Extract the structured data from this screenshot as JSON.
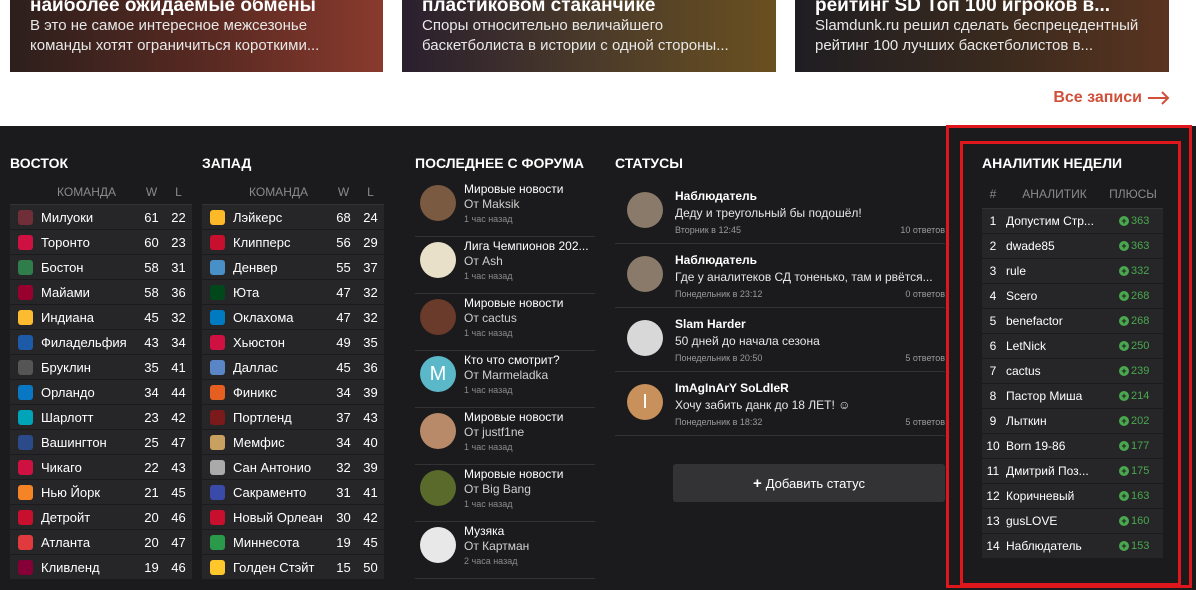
{
  "cards": [
    {
      "title": "наиболее ожидаемые обмены",
      "text1": "В это не самое интересное межсезонье",
      "text2": "команды хотят ограничиться короткими..."
    },
    {
      "title": "пластиковом стаканчике",
      "text1": "Споры относительно величайшего",
      "text2": "баскетболиста в истории с одной стороны..."
    },
    {
      "title": "рейтинг SD Топ 100 игроков в...",
      "text1": "Slamdunk.ru решил сделать беспрецедентный",
      "text2": "рейтинг 100 лучших баскетболистов в..."
    }
  ],
  "all_link": "Все записи",
  "east": {
    "title": "ВОСТОК",
    "col_team": "КОМАНДА",
    "col_w": "W",
    "col_l": "L",
    "rows": [
      {
        "name": "Милуоки",
        "w": "61",
        "l": "22",
        "color": "#702f38"
      },
      {
        "name": "Торонто",
        "w": "60",
        "l": "23",
        "color": "#ce1141"
      },
      {
        "name": "Бостон",
        "w": "58",
        "l": "31",
        "color": "#2e7d4a"
      },
      {
        "name": "Майами",
        "w": "58",
        "l": "36",
        "color": "#98002e"
      },
      {
        "name": "Индиана",
        "w": "45",
        "l": "32",
        "color": "#fdbb30"
      },
      {
        "name": "Филадельфия",
        "w": "43",
        "l": "34",
        "color": "#1d5aa8"
      },
      {
        "name": "Бруклин",
        "w": "35",
        "l": "41",
        "color": "#555555"
      },
      {
        "name": "Орландо",
        "w": "34",
        "l": "44",
        "color": "#0a77c4"
      },
      {
        "name": "Шарлотт",
        "w": "23",
        "l": "42",
        "color": "#00a4b8"
      },
      {
        "name": "Вашингтон",
        "w": "25",
        "l": "47",
        "color": "#2a4a8a"
      },
      {
        "name": "Чикаго",
        "w": "22",
        "l": "43",
        "color": "#ce1141"
      },
      {
        "name": "Нью Йорк",
        "w": "21",
        "l": "45",
        "color": "#f58426"
      },
      {
        "name": "Детройт",
        "w": "20",
        "l": "46",
        "color": "#c8102e"
      },
      {
        "name": "Атланта",
        "w": "20",
        "l": "47",
        "color": "#e03a3e"
      },
      {
        "name": "Кливленд",
        "w": "19",
        "l": "46",
        "color": "#860038"
      }
    ]
  },
  "west": {
    "title": "ЗАПАД",
    "col_team": "КОМАНДА",
    "col_w": "W",
    "col_l": "L",
    "rows": [
      {
        "name": "Лэйкерс",
        "w": "68",
        "l": "24",
        "color": "#fdb927"
      },
      {
        "name": "Клипперс",
        "w": "56",
        "l": "29",
        "color": "#c8102e"
      },
      {
        "name": "Денвер",
        "w": "55",
        "l": "37",
        "color": "#4a90c8"
      },
      {
        "name": "Юта",
        "w": "47",
        "l": "32",
        "color": "#00471b"
      },
      {
        "name": "Оклахома",
        "w": "47",
        "l": "32",
        "color": "#007ac1"
      },
      {
        "name": "Хьюстон",
        "w": "49",
        "l": "35",
        "color": "#ce1141"
      },
      {
        "name": "Даллас",
        "w": "45",
        "l": "36",
        "color": "#5a86c8"
      },
      {
        "name": "Финикс",
        "w": "34",
        "l": "39",
        "color": "#e56020"
      },
      {
        "name": "Портленд",
        "w": "37",
        "l": "43",
        "color": "#7a1a1a"
      },
      {
        "name": "Мемфис",
        "w": "34",
        "l": "40",
        "color": "#c8a060"
      },
      {
        "name": "Сан Антонио",
        "w": "32",
        "l": "39",
        "color": "#aaaaaa"
      },
      {
        "name": "Сакраменто",
        "w": "31",
        "l": "41",
        "color": "#3a4aa8"
      },
      {
        "name": "Новый Орлеан",
        "w": "30",
        "l": "42",
        "color": "#c8102e"
      },
      {
        "name": "Миннесота",
        "w": "19",
        "l": "45",
        "color": "#2a9a4a"
      },
      {
        "name": "Голден Стэйт",
        "w": "15",
        "l": "50",
        "color": "#ffc72c"
      }
    ]
  },
  "forum": {
    "title": "ПОСЛЕДНЕЕ С ФОРУМА",
    "items": [
      {
        "topic": "Мировые новости",
        "author": "От Maksik",
        "date": "1 час назад",
        "ava": "#7a5a40"
      },
      {
        "topic": "Лига Чемпионов 202...",
        "author": "От Ash",
        "date": "1 час назад",
        "ava": "#e8e0c8"
      },
      {
        "topic": "Мировые новости",
        "author": "От cactus",
        "date": "1 час назад",
        "ava": "#6a3a2a"
      },
      {
        "topic": "Кто что смотрит?",
        "author": "От Marmeladka",
        "date": "1 час назад",
        "ava": "#5ab8c8",
        "letter": "M"
      },
      {
        "topic": "Мировые новости",
        "author": "От justf1ne",
        "date": "1 час назад",
        "ava": "#b88a6a"
      },
      {
        "topic": "Мировые новости",
        "author": "От Big Bang",
        "date": "1 час назад",
        "ava": "#5a6a2a"
      },
      {
        "topic": "Музяка",
        "author": "От Картман",
        "date": "2 часа назад",
        "ava": "#e8e8e8"
      }
    ]
  },
  "statuses": {
    "title": "СТАТУСЫ",
    "items": [
      {
        "name": "Наблюдатель",
        "text": "Деду и треугольный бы подошёл!",
        "date": "Вторник в 12:45",
        "replies": "10 ответов",
        "ava": "#8a7a6a"
      },
      {
        "name": "Наблюдатель",
        "text": "Где у аналитеков СД тоненько, там и рвётся...",
        "date": "Понедельник в 23:12",
        "replies": "0 ответов",
        "ava": "#8a7a6a"
      },
      {
        "name": "Slam Harder",
        "text": "50 дней до начала сезона",
        "date": "Понедельник в 20:50",
        "replies": "5 ответов",
        "ava": "#d8d8d8"
      },
      {
        "name": "ImAgInArY SoLdIeR",
        "text": "Хочу забить данк до 18 ЛЕТ! ☺",
        "date": "Понедельник в 18:32",
        "replies": "5 ответов",
        "ava": "#c8905a",
        "letter": "I"
      }
    ],
    "add_label": "Добавить статус"
  },
  "analyst": {
    "title": "АНАЛИТИК НЕДЕЛИ",
    "col_n": "#",
    "col_name": "АНАЛИТИК",
    "col_pts": "ПЛЮСЫ",
    "rows": [
      {
        "n": "1",
        "name": "Допустим Стр...",
        "pts": "363"
      },
      {
        "n": "2",
        "name": "dwade85",
        "pts": "363"
      },
      {
        "n": "3",
        "name": "rule",
        "pts": "332"
      },
      {
        "n": "4",
        "name": "Scero",
        "pts": "268"
      },
      {
        "n": "5",
        "name": "benefactor",
        "pts": "268"
      },
      {
        "n": "6",
        "name": "LetNick",
        "pts": "250"
      },
      {
        "n": "7",
        "name": "cactus",
        "pts": "239"
      },
      {
        "n": "8",
        "name": "Пастор Миша",
        "pts": "214"
      },
      {
        "n": "9",
        "name": "Лыткин",
        "pts": "202"
      },
      {
        "n": "10",
        "name": "Born 19-86",
        "pts": "177"
      },
      {
        "n": "11",
        "name": "Дмитрий Поз...",
        "pts": "175"
      },
      {
        "n": "12",
        "name": "Коричневый",
        "pts": "163"
      },
      {
        "n": "13",
        "name": "gusLOVE",
        "pts": "160"
      },
      {
        "n": "14",
        "name": "Наблюдатель",
        "pts": "153"
      }
    ]
  },
  "colors": {
    "accent": "#d0503a",
    "highlight": "#e0161d",
    "positive": "#4aa84f",
    "bg_dark": "#1b1b1d"
  }
}
